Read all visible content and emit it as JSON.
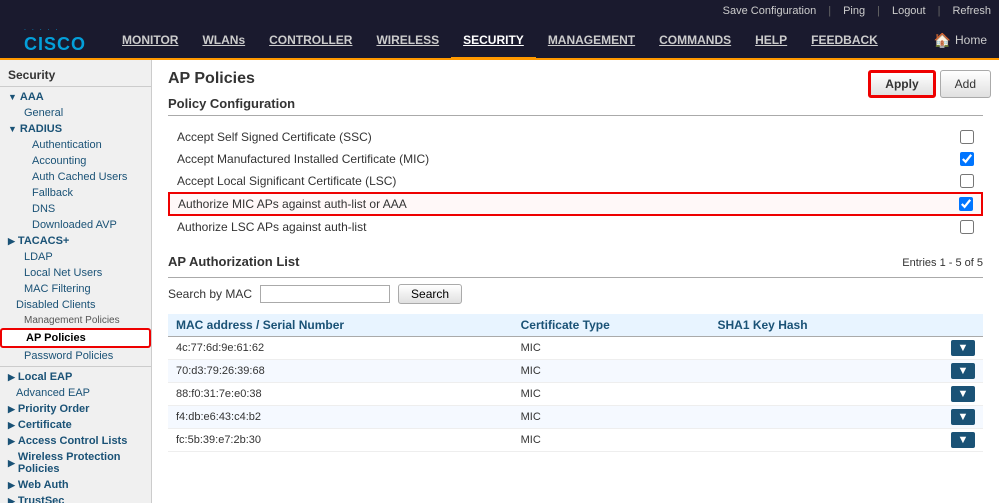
{
  "topbar": {
    "save_config": "Save Configuration",
    "ping": "Ping",
    "logout": "Logout",
    "refresh": "Refresh"
  },
  "nav": {
    "monitor": "MONITOR",
    "wlans": "WLANs",
    "controller": "CONTROLLER",
    "wireless": "WIRELESS",
    "security": "SECURITY",
    "management": "MANAGEMENT",
    "commands": "COMMANDS",
    "help": "HELP",
    "feedback": "FEEDBACK",
    "home": "Home"
  },
  "sidebar": {
    "security_title": "Security",
    "aaa": "AAA",
    "general": "General",
    "radius": "RADIUS",
    "authentication": "Authentication",
    "accounting": "Accounting",
    "auth_cached_users": "Auth Cached Users",
    "fallback": "Fallback",
    "dns": "DNS",
    "downloaded_avp": "Downloaded AVP",
    "tacacs_plus": "TACACS+",
    "ldap": "LDAP",
    "local_net_users": "Local Net Users",
    "mac_filtering": "MAC Filtering",
    "disabled_clients": "Disabled Clients",
    "management_policies": "Management Policies",
    "ap_policies": "AP Policies",
    "password_policies": "Password Policies",
    "local_eap": "Local EAP",
    "advanced_eap": "Advanced EAP",
    "priority_order": "Priority Order",
    "certificate": "Certificate",
    "access_control_lists": "Access Control Lists",
    "wireless_protection_policies": "Wireless Protection Policies",
    "web_auth": "Web Auth",
    "trustsec": "TrustSec"
  },
  "content": {
    "page_title": "AP Policies",
    "apply_btn": "Apply",
    "add_btn": "Add",
    "policy_config_title": "Policy Configuration",
    "policies": [
      {
        "label": "Accept Self Signed Certificate (SSC)",
        "checked": false,
        "highlighted": false
      },
      {
        "label": "Accept Manufactured Installed Certificate (MIC)",
        "checked": true,
        "highlighted": false
      },
      {
        "label": "Accept Local Significant Certificate (LSC)",
        "checked": false,
        "highlighted": false
      },
      {
        "label": "Authorize MIC APs against auth-list or AAA",
        "checked": true,
        "highlighted": true
      },
      {
        "label": "Authorize LSC APs against auth-list",
        "checked": false,
        "highlighted": false
      }
    ],
    "auth_list_title": "AP Authorization List",
    "entries_info": "Entries 1 - 5 of 5",
    "search_label": "Search by MAC",
    "search_placeholder": "",
    "search_btn": "Search",
    "table_headers": [
      "MAC address / Serial Number",
      "Certificate Type",
      "SHA1 Key Hash",
      ""
    ],
    "table_rows": [
      {
        "mac": "4c:77:6d:9e:61:62",
        "cert_type": "MIC",
        "sha1": ""
      },
      {
        "mac": "70:d3:79:26:39:68",
        "cert_type": "MIC",
        "sha1": ""
      },
      {
        "mac": "88:f0:31:7e:e0:38",
        "cert_type": "MIC",
        "sha1": ""
      },
      {
        "mac": "f4:db:e6:43:c4:b2",
        "cert_type": "MIC",
        "sha1": ""
      },
      {
        "mac": "fc:5b:39:e7:2b:30",
        "cert_type": "MIC",
        "sha1": ""
      }
    ]
  }
}
